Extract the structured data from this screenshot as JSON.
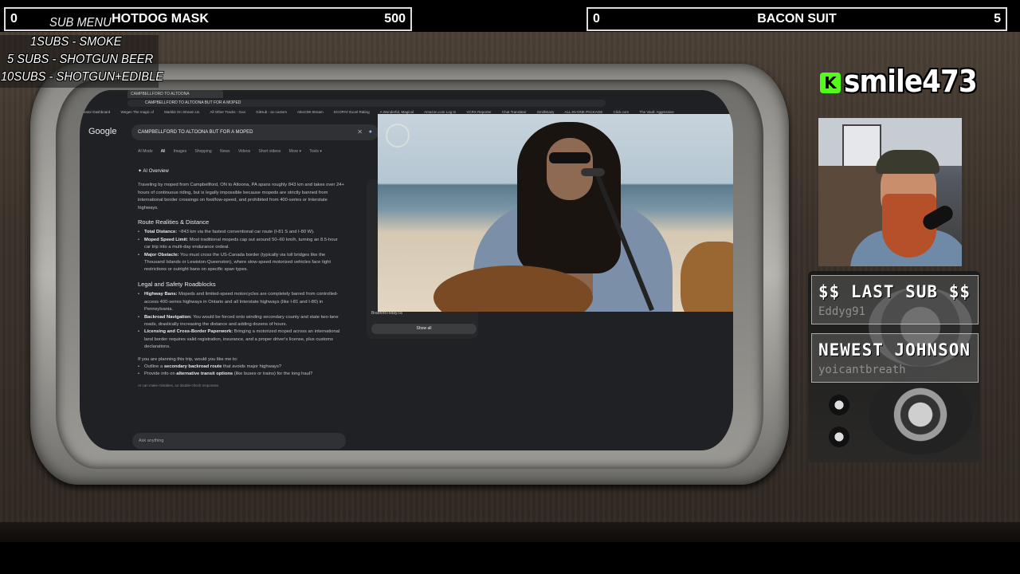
{
  "goals": [
    {
      "current": "0",
      "name": "HOTDOG MASK",
      "target": "500"
    },
    {
      "current": "0",
      "name": "BACON SUIT",
      "target": "5"
    }
  ],
  "sub_menu": {
    "title": "SUB MENU",
    "items": [
      "1SUBS   - SMOKE",
      "5 SUBS  - SHOTGUN BEER",
      "10SUBS - SHOTGUN+EDIBLE"
    ]
  },
  "browser": {
    "tab_title": "CAMPBELLFORD TO ALTOONA",
    "url": "CAMPBELLFORD TO ALTOONA BUT FOR A MOPED",
    "bookmarks": [
      "Creator Dashboard",
      "Wegen The magic of",
      "Markkit On Stream Us",
      "All Other Tracks - Goo",
      "GitHub - ac-custom",
      "AlexC99 Stream",
      "ECOPAY Excel Rating",
      "A Wonderful, Magical",
      "Amazon.com Log In",
      "VCRX Reporter",
      "Chat Translator",
      "SmithEasy",
      "ALL-IN-ONE PACKAGE",
      "Click.com",
      "The Vault: Aggressive"
    ],
    "google_label": "Google",
    "query": "CAMPBELLFORD TO ALTOONA BUT FOR A MOPED",
    "tabs": [
      "AI Mode",
      "All",
      "Images",
      "Shopping",
      "News",
      "Videos",
      "Short videos",
      "More ▾",
      "Tools ▾"
    ],
    "ai_overview_label": "AI Overview",
    "intro": "Traveling by moped from Campbellford, ON to Altoona, PA spans roughly 843 km and takes over 24+ hours of continuous riding, but is legally impossible because mopeds are strictly banned from international border crossings on foot/low-speed, and prohibited from 400-series or Interstate highways.",
    "section1": "Route Realities & Distance",
    "s1_items": [
      {
        "bold": "Total Distance:",
        "text": " ~843 km via the fastest conventional car route (I-81 S and I-80 W)."
      },
      {
        "bold": "Moped Speed Limit:",
        "text": " Most traditional mopeds cap out around 50–60 km/h, turning an 8.5-hour car trip into a multi-day endurance ordeal."
      },
      {
        "bold": "Major Obstacle:",
        "text": " You must cross the US-Canada border (typically via toll bridges like the Thousand Islands or Lewiston-Queenston), where slow-speed motorized vehicles face tight restrictions or outright bans on specific span types."
      }
    ],
    "section2": "Legal and Safety Roadblocks",
    "s2_items": [
      {
        "bold": "Highway Bans:",
        "text": " Mopeds and limited-speed motorcycles are completely barred from controlled-access 400-series highways in Ontario and all Interstate highways (like I-81 and I-80) in Pennsylvania."
      },
      {
        "bold": "Backroad Navigation:",
        "text": " You would be forced onto winding secondary county and state two-lane roads, drastically increasing the distance and adding dozens of hours."
      },
      {
        "bold": "Licensing and Cross-Border Paperwork:",
        "text": " Bringing a motorized moped across an international land border requires valid registration, insurance, and a proper driver's license, plus customs declarations."
      }
    ],
    "followup_q": "If you are planning this trip, would you like me to:",
    "followups": [
      {
        "pre": "Outline a ",
        "bold": "secondary backroad route",
        "post": " that avoids major highways?"
      },
      {
        "pre": "Provide info on ",
        "bold": "alternative transit options",
        "post": " (like buses or trains) for the long haul?"
      }
    ],
    "disclaimer": "AI can make mistakes, so double-check responses",
    "ask_placeholder": "Ask anything",
    "source_label": "BradfordToday.ca",
    "show_all": "Show all"
  },
  "kick": {
    "logo_letter": "K",
    "username": "smile473"
  },
  "last_sub": {
    "title": "$$ LAST SUB $$",
    "value": "Eddyg91"
  },
  "newest": {
    "title": "NEWEST JOHNSON",
    "value": "yoicantbreath"
  }
}
